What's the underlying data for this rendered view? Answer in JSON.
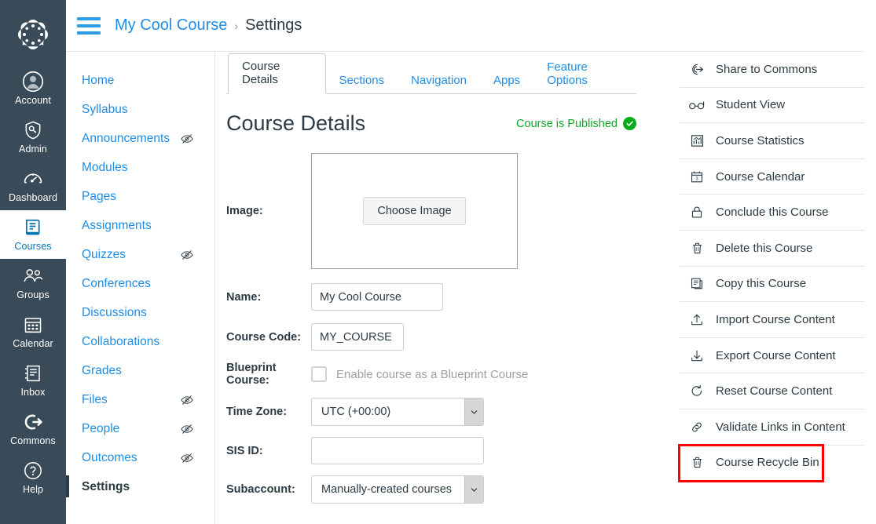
{
  "global_nav": {
    "logo_name": "canvas-logo",
    "items": [
      {
        "label": "Account",
        "icon": "user-avatar-icon",
        "active": false
      },
      {
        "label": "Admin",
        "icon": "shield-key-icon",
        "active": false
      },
      {
        "label": "Dashboard",
        "icon": "dashboard-icon",
        "active": false
      },
      {
        "label": "Courses",
        "icon": "book-icon",
        "active": true
      },
      {
        "label": "Groups",
        "icon": "people-icon",
        "active": false
      },
      {
        "label": "Calendar",
        "icon": "calendar-icon",
        "active": false
      },
      {
        "label": "Inbox",
        "icon": "inbox-icon",
        "active": false
      },
      {
        "label": "Commons",
        "icon": "commons-arrow-icon",
        "active": false
      },
      {
        "label": "Help",
        "icon": "question-mark-icon",
        "active": false
      }
    ]
  },
  "breadcrumb": {
    "menu_icon": "hamburger-icon",
    "course": "My Cool Course",
    "separator": "›",
    "current": "Settings"
  },
  "course_nav": {
    "items": [
      {
        "label": "Home",
        "hidden": false,
        "active": false
      },
      {
        "label": "Syllabus",
        "hidden": false,
        "active": false
      },
      {
        "label": "Announcements",
        "hidden": true,
        "active": false
      },
      {
        "label": "Modules",
        "hidden": false,
        "active": false
      },
      {
        "label": "Pages",
        "hidden": false,
        "active": false
      },
      {
        "label": "Assignments",
        "hidden": false,
        "active": false
      },
      {
        "label": "Quizzes",
        "hidden": true,
        "active": false
      },
      {
        "label": "Conferences",
        "hidden": false,
        "active": false
      },
      {
        "label": "Discussions",
        "hidden": false,
        "active": false
      },
      {
        "label": "Collaborations",
        "hidden": false,
        "active": false
      },
      {
        "label": "Grades",
        "hidden": false,
        "active": false
      },
      {
        "label": "Files",
        "hidden": true,
        "active": false
      },
      {
        "label": "People",
        "hidden": true,
        "active": false
      },
      {
        "label": "Outcomes",
        "hidden": true,
        "active": false
      },
      {
        "label": "Settings",
        "hidden": false,
        "active": true
      }
    ]
  },
  "tabs": [
    {
      "label": "Course Details",
      "active": true
    },
    {
      "label": "Sections",
      "active": false
    },
    {
      "label": "Navigation",
      "active": false
    },
    {
      "label": "Apps",
      "active": false
    },
    {
      "label": "Feature Options",
      "active": false
    }
  ],
  "page": {
    "title": "Course Details",
    "publish_status": "Course is Published",
    "publish_icon": "check-circle-icon"
  },
  "form": {
    "image": {
      "label": "Image:",
      "button_label": "Choose Image"
    },
    "name": {
      "label": "Name:",
      "value": "My Cool Course"
    },
    "course_code": {
      "label": "Course Code:",
      "value": "MY_COURSE"
    },
    "blueprint": {
      "label": "Blueprint Course:",
      "checkbox_label": "Enable course as a Blueprint Course",
      "checked": false,
      "disabled": true
    },
    "time_zone": {
      "label": "Time Zone:",
      "value": "UTC (+00:00)"
    },
    "sis_id": {
      "label": "SIS ID:",
      "value": ""
    },
    "subaccount": {
      "label": "Subaccount:",
      "value": "Manually-created courses"
    }
  },
  "sidebar": {
    "items": [
      {
        "label": "Share to Commons",
        "icon": "commons-icon",
        "highlight": false
      },
      {
        "label": "Student View",
        "icon": "glasses-icon",
        "highlight": false
      },
      {
        "label": "Course Statistics",
        "icon": "bar-chart-icon",
        "highlight": false
      },
      {
        "label": "Course Calendar",
        "icon": "calendar-icon",
        "highlight": false
      },
      {
        "label": "Conclude this Course",
        "icon": "lock-icon",
        "highlight": false
      },
      {
        "label": "Delete this Course",
        "icon": "trash-icon",
        "highlight": false
      },
      {
        "label": "Copy this Course",
        "icon": "copy-icon",
        "highlight": false
      },
      {
        "label": "Import Course Content",
        "icon": "upload-icon",
        "highlight": false
      },
      {
        "label": "Export Course Content",
        "icon": "download-icon",
        "highlight": false
      },
      {
        "label": "Reset Course Content",
        "icon": "reset-icon",
        "highlight": false
      },
      {
        "label": "Validate Links in Content",
        "icon": "link-icon",
        "highlight": false
      },
      {
        "label": "Course Recycle Bin",
        "icon": "trash-icon",
        "highlight": true
      }
    ]
  },
  "colors": {
    "nav_background": "#394B58",
    "link_blue": "#1E8DE6",
    "text_dark": "#2D3B45",
    "published_green": "#00AC18",
    "highlight_red": "#FF0000"
  }
}
